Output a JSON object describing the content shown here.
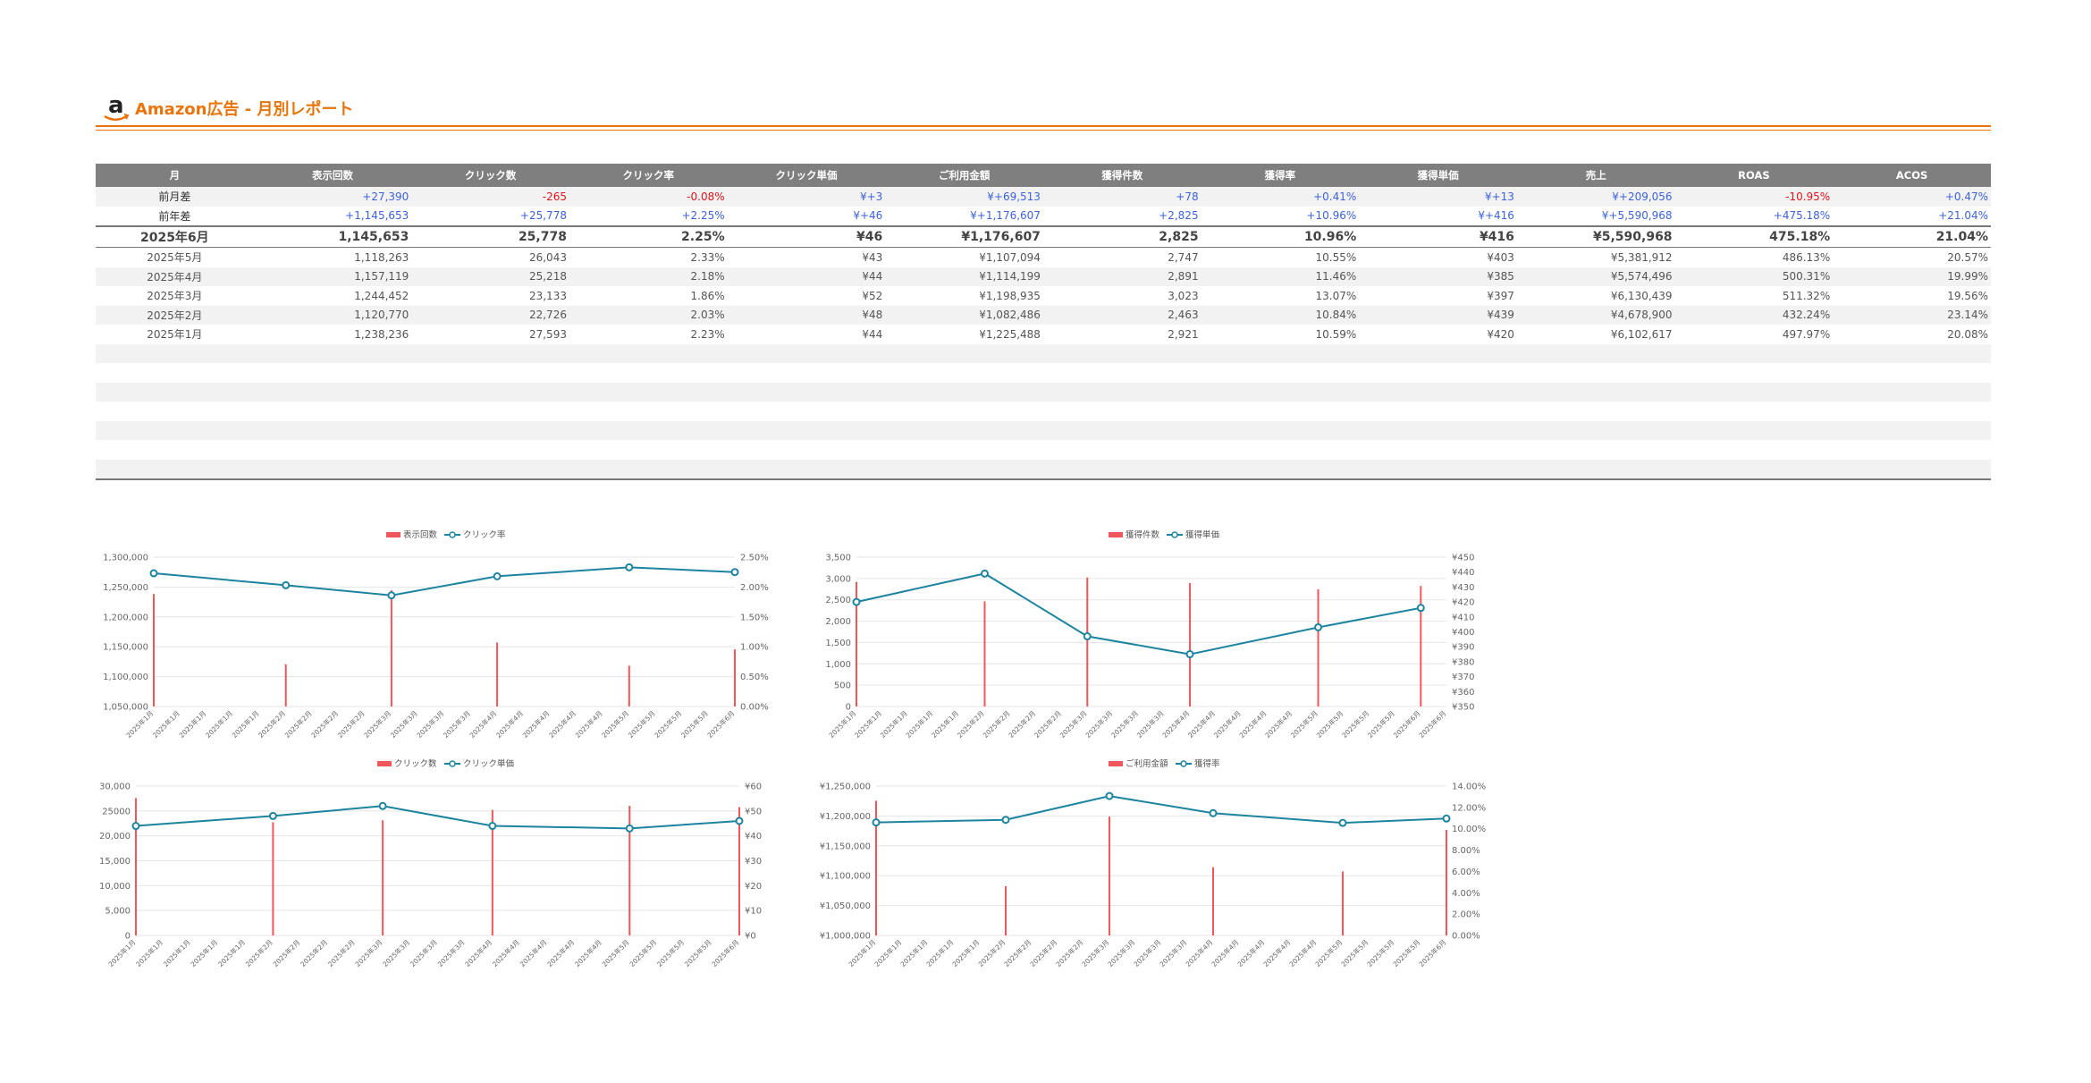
{
  "header": {
    "title": "Amazon広告 - 月別レポート",
    "logo_letter": "a"
  },
  "colors": {
    "accent": "#e8740c",
    "bar": "#f0575b",
    "line": "#1d84a0",
    "pos": "#3d63d9",
    "neg": "#e0141c",
    "header_bg": "#7f7f7f"
  },
  "table": {
    "columns": [
      "月",
      "表示回数",
      "クリック数",
      "クリック率",
      "クリック単価",
      "ご利用金額",
      "獲得件数",
      "獲得率",
      "獲得単価",
      "売上",
      "ROAS",
      "ACOS"
    ],
    "diff_rows": [
      {
        "cells": [
          "前月差",
          "+27,390",
          "-265",
          "-0.08%",
          "¥+3",
          "¥+69,513",
          "+78",
          "+0.41%",
          "¥+13",
          "¥+209,056",
          "-10.95%",
          "+0.47%"
        ],
        "signs": [
          "",
          "pos",
          "neg",
          "neg",
          "pos",
          "pos",
          "pos",
          "pos",
          "pos",
          "pos",
          "neg",
          "pos"
        ]
      },
      {
        "cells": [
          "前年差",
          "+1,145,653",
          "+25,778",
          "+2.25%",
          "¥+46",
          "¥+1,176,607",
          "+2,825",
          "+10.96%",
          "¥+416",
          "¥+5,590,968",
          "+475.18%",
          "+21.04%"
        ],
        "signs": [
          "",
          "pos",
          "pos",
          "pos",
          "pos",
          "pos",
          "pos",
          "pos",
          "pos",
          "pos",
          "pos",
          "pos"
        ]
      }
    ],
    "current_row": [
      "2025年6月",
      "1,145,653",
      "25,778",
      "2.25%",
      "¥46",
      "¥1,176,607",
      "2,825",
      "10.96%",
      "¥416",
      "¥5,590,968",
      "475.18%",
      "21.04%"
    ],
    "history_rows": [
      [
        "2025年5月",
        "1,118,263",
        "26,043",
        "2.33%",
        "¥43",
        "¥1,107,094",
        "2,747",
        "10.55%",
        "¥403",
        "¥5,381,912",
        "486.13%",
        "20.57%"
      ],
      [
        "2025年4月",
        "1,157,119",
        "25,218",
        "2.18%",
        "¥44",
        "¥1,114,199",
        "2,891",
        "11.46%",
        "¥385",
        "¥5,574,496",
        "500.31%",
        "19.99%"
      ],
      [
        "2025年3月",
        "1,244,452",
        "23,133",
        "1.86%",
        "¥52",
        "¥1,198,935",
        "3,023",
        "13.07%",
        "¥397",
        "¥6,130,439",
        "511.32%",
        "19.56%"
      ],
      [
        "2025年2月",
        "1,120,770",
        "22,726",
        "2.03%",
        "¥48",
        "¥1,082,486",
        "2,463",
        "10.84%",
        "¥439",
        "¥4,678,900",
        "432.24%",
        "23.14%"
      ],
      [
        "2025年1月",
        "1,238,236",
        "27,593",
        "2.23%",
        "¥44",
        "¥1,225,488",
        "2,921",
        "10.59%",
        "¥420",
        "¥6,102,617",
        "497.97%",
        "20.08%"
      ]
    ]
  },
  "chart_data": [
    {
      "type": "bar+line",
      "legend": [
        "表示回数",
        "クリック率"
      ],
      "categories": [
        "2025年1月",
        "2025年1月",
        "2025年1月",
        "2025年1月",
        "2025年1月",
        "2025年2月",
        "2025年2月",
        "2025年2月",
        "2025年2月",
        "2025年3月",
        "2025年3月",
        "2025年3月",
        "2025年3月",
        "2025年4月",
        "2025年4月",
        "2025年4月",
        "2025年4月",
        "2025年4月",
        "2025年5月",
        "2025年5月",
        "2025年5月",
        "2025年5月",
        "2025年6月"
      ],
      "bars": [
        {
          "index": 0,
          "value": 1238236
        },
        {
          "index": 5,
          "value": 1120770
        },
        {
          "index": 9,
          "value": 1244452
        },
        {
          "index": 13,
          "value": 1157119
        },
        {
          "index": 18,
          "value": 1118263
        },
        {
          "index": 22,
          "value": 1145653
        }
      ],
      "line": [
        {
          "index": 0,
          "value": 2.23
        },
        {
          "index": 5,
          "value": 2.03
        },
        {
          "index": 9,
          "value": 1.86
        },
        {
          "index": 13,
          "value": 2.18
        },
        {
          "index": 18,
          "value": 2.33
        },
        {
          "index": 22,
          "value": 2.25
        }
      ],
      "y_left": {
        "min": 1050000,
        "max": 1300000,
        "ticks": [
          "1,050,000",
          "1,100,000",
          "1,150,000",
          "1,200,000",
          "1,250,000",
          "1,300,000"
        ]
      },
      "y_right": {
        "min": 0,
        "max": 2.5,
        "ticks": [
          "0.00%",
          "0.50%",
          "1.00%",
          "1.50%",
          "2.00%",
          "2.50%"
        ]
      }
    },
    {
      "type": "bar+line",
      "legend": [
        "獲得件数",
        "獲得単価"
      ],
      "categories": [
        "2025年1月",
        "2025年1月",
        "2025年1月",
        "2025年1月",
        "2025年1月",
        "2025年2月",
        "2025年2月",
        "2025年2月",
        "2025年2月",
        "2025年3月",
        "2025年3月",
        "2025年3月",
        "2025年3月",
        "2025年4月",
        "2025年4月",
        "2025年4月",
        "2025年4月",
        "2025年4月",
        "2025年5月",
        "2025年5月",
        "2025年5月",
        "2025年5月",
        "2025年6月",
        "2025年6月"
      ],
      "bars": [
        {
          "index": 0,
          "value": 2921
        },
        {
          "index": 5,
          "value": 2463
        },
        {
          "index": 9,
          "value": 3023
        },
        {
          "index": 13,
          "value": 2891
        },
        {
          "index": 18,
          "value": 2747
        },
        {
          "index": 22,
          "value": 2825
        }
      ],
      "line": [
        {
          "index": 0,
          "value": 420
        },
        {
          "index": 5,
          "value": 439
        },
        {
          "index": 9,
          "value": 397
        },
        {
          "index": 13,
          "value": 385
        },
        {
          "index": 18,
          "value": 403
        },
        {
          "index": 22,
          "value": 416
        }
      ],
      "y_left": {
        "min": 0,
        "max": 3500,
        "ticks": [
          "0",
          "500",
          "1,000",
          "1,500",
          "2,000",
          "2,500",
          "3,000",
          "3,500"
        ]
      },
      "y_right": {
        "min": 350,
        "max": 450,
        "ticks": [
          "¥350",
          "¥360",
          "¥370",
          "¥380",
          "¥390",
          "¥400",
          "¥410",
          "¥420",
          "¥430",
          "¥440",
          "¥450"
        ]
      }
    },
    {
      "type": "bar+line",
      "legend": [
        "クリック数",
        "クリック単価"
      ],
      "categories": [
        "2025年1月",
        "2025年1月",
        "2025年1月",
        "2025年1月",
        "2025年1月",
        "2025年2月",
        "2025年2月",
        "2025年2月",
        "2025年2月",
        "2025年3月",
        "2025年3月",
        "2025年3月",
        "2025年3月",
        "2025年4月",
        "2025年4月",
        "2025年4月",
        "2025年4月",
        "2025年4月",
        "2025年5月",
        "2025年5月",
        "2025年5月",
        "2025年5月",
        "2025年6月"
      ],
      "bars": [
        {
          "index": 0,
          "value": 27593
        },
        {
          "index": 5,
          "value": 22726
        },
        {
          "index": 9,
          "value": 23133
        },
        {
          "index": 13,
          "value": 25218
        },
        {
          "index": 18,
          "value": 26043
        },
        {
          "index": 22,
          "value": 25778
        }
      ],
      "line": [
        {
          "index": 0,
          "value": 44
        },
        {
          "index": 5,
          "value": 48
        },
        {
          "index": 9,
          "value": 52
        },
        {
          "index": 13,
          "value": 44
        },
        {
          "index": 18,
          "value": 43
        },
        {
          "index": 22,
          "value": 46
        }
      ],
      "y_left": {
        "min": 0,
        "max": 30000,
        "ticks": [
          "0",
          "5,000",
          "10,000",
          "15,000",
          "20,000",
          "25000",
          "30,000"
        ]
      },
      "y_right": {
        "min": 0,
        "max": 60,
        "ticks": [
          "¥0",
          "¥10",
          "¥20",
          "¥30",
          "¥40",
          "¥50",
          "¥60"
        ]
      }
    },
    {
      "type": "bar+line",
      "legend": [
        "ご利用金額",
        "獲得率"
      ],
      "categories": [
        "2025年1月",
        "2025年1月",
        "2025年1月",
        "2025年1月",
        "2025年1月",
        "2025年2月",
        "2025年2月",
        "2025年2月",
        "2025年2月",
        "2025年3月",
        "2025年3月",
        "2025年3月",
        "2025年3月",
        "2025年4月",
        "2025年4月",
        "2025年4月",
        "2025年4月",
        "2025年4月",
        "2025年5月",
        "2025年5月",
        "2025年5月",
        "2025年5月",
        "2025年6月"
      ],
      "bars": [
        {
          "index": 0,
          "value": 1225488
        },
        {
          "index": 5,
          "value": 1082486
        },
        {
          "index": 9,
          "value": 1198935
        },
        {
          "index": 13,
          "value": 1114199
        },
        {
          "index": 18,
          "value": 1107094
        },
        {
          "index": 22,
          "value": 1176607
        }
      ],
      "line": [
        {
          "index": 0,
          "value": 10.59
        },
        {
          "index": 5,
          "value": 10.84
        },
        {
          "index": 9,
          "value": 13.07
        },
        {
          "index": 13,
          "value": 11.46
        },
        {
          "index": 18,
          "value": 10.55
        },
        {
          "index": 22,
          "value": 10.96
        }
      ],
      "y_left": {
        "min": 1000000,
        "max": 1250000,
        "ticks": [
          "¥1,000,000",
          "¥1,050,000",
          "¥1,100,000",
          "¥1,150,000",
          "¥1,200,000",
          "¥1,250,000"
        ]
      },
      "y_right": {
        "min": 0,
        "max": 14,
        "ticks": [
          "0.00%",
          "2.00%",
          "4.00%",
          "6.00%",
          "8.00%",
          "10.00%",
          "12.00%",
          "14.00%"
        ]
      }
    }
  ]
}
